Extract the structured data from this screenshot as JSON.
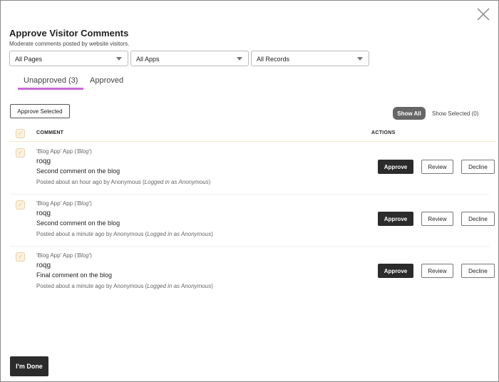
{
  "title": "Approve Visitor Comments",
  "subtitle": "Moderate comments posted by website visitors.",
  "filters": [
    "All Pages",
    "All Apps",
    "All Records"
  ],
  "tabs": [
    {
      "label": "Unapproved (3)",
      "active": true
    },
    {
      "label": "Approved",
      "active": false
    }
  ],
  "approve_selected": "Approve Selected",
  "show_all": "Show All",
  "show_selected": "Show Selected (0)",
  "columns": {
    "comment": "COMMENT",
    "actions": "ACTIONS"
  },
  "comments": [
    {
      "app": "'Blog App' App (",
      "app_name": "'Blog'",
      "app_close": ")",
      "user": "roqg",
      "text": "Second comment on the blog",
      "meta": "Posted about an hour ago by Anonymous (",
      "meta_em": "Logged in as Anonymous",
      "meta_close": ")"
    },
    {
      "app": "'Blog App' App (",
      "app_name": "'Blog'",
      "app_close": ")",
      "user": "roqg",
      "text": "Second comment on the blog",
      "meta": "Posted about a minute ago by Anonymous (",
      "meta_em": "Logged in as Anonymous",
      "meta_close": ")"
    },
    {
      "app": "'Blog App' App (",
      "app_name": "'Blog'",
      "app_close": ")",
      "user": "roqg",
      "text": "Final comment on the blog",
      "meta": "Posted about a minute ago by Anonymous (",
      "meta_em": "Logged in as Anonymous",
      "meta_close": ")"
    }
  ],
  "actions": {
    "approve": "Approve",
    "review": "Review",
    "decline": "Decline"
  },
  "done": "I'm Done",
  "colors": {
    "tab_underline": "#c86ad8",
    "primary": "#2b2b2b"
  }
}
